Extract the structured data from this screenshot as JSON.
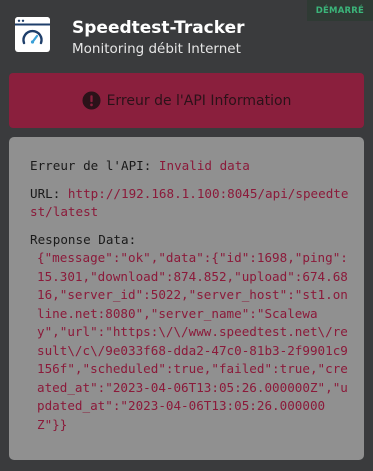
{
  "header": {
    "title": "Speedtest-Tracker",
    "subtitle": "Monitoring débit Internet",
    "status": "DÉMARRÉ",
    "icon": "speedometer-window-icon"
  },
  "error_banner": {
    "icon": "alert-circle-icon",
    "text": "Erreur de l'API Information"
  },
  "details": {
    "error_label": "Erreur de l'API: ",
    "error_value": "Invalid data",
    "url_label": "URL: ",
    "url_value": "http://192.168.1.100:8045/api/speedtest/latest",
    "response_label": "Response Data:",
    "response_value": "{\"message\":\"ok\",\"data\":{\"id\":1698,\"ping\":15.301,\"download\":874.852,\"upload\":674.6816,\"server_id\":5022,\"server_host\":\"st1.online.net:8080\",\"server_name\":\"Scaleway\",\"url\":\"https:\\/\\/www.speedtest.net\\/result\\/c\\/9e033f68-dda2-47c0-81b3-2f9901c9156f\",\"scheduled\":true,\"failed\":true,\"created_at\":\"2023-04-06T13:05:26.000000Z\",\"updated_at\":\"2023-04-06T13:05:26.000000Z\"}}"
  },
  "colors": {
    "background": "#3a3b3d",
    "badge_text": "#3bb67a",
    "banner": "#8a1f3d",
    "panel": "#909090",
    "value_text": "#8b1a3a"
  }
}
